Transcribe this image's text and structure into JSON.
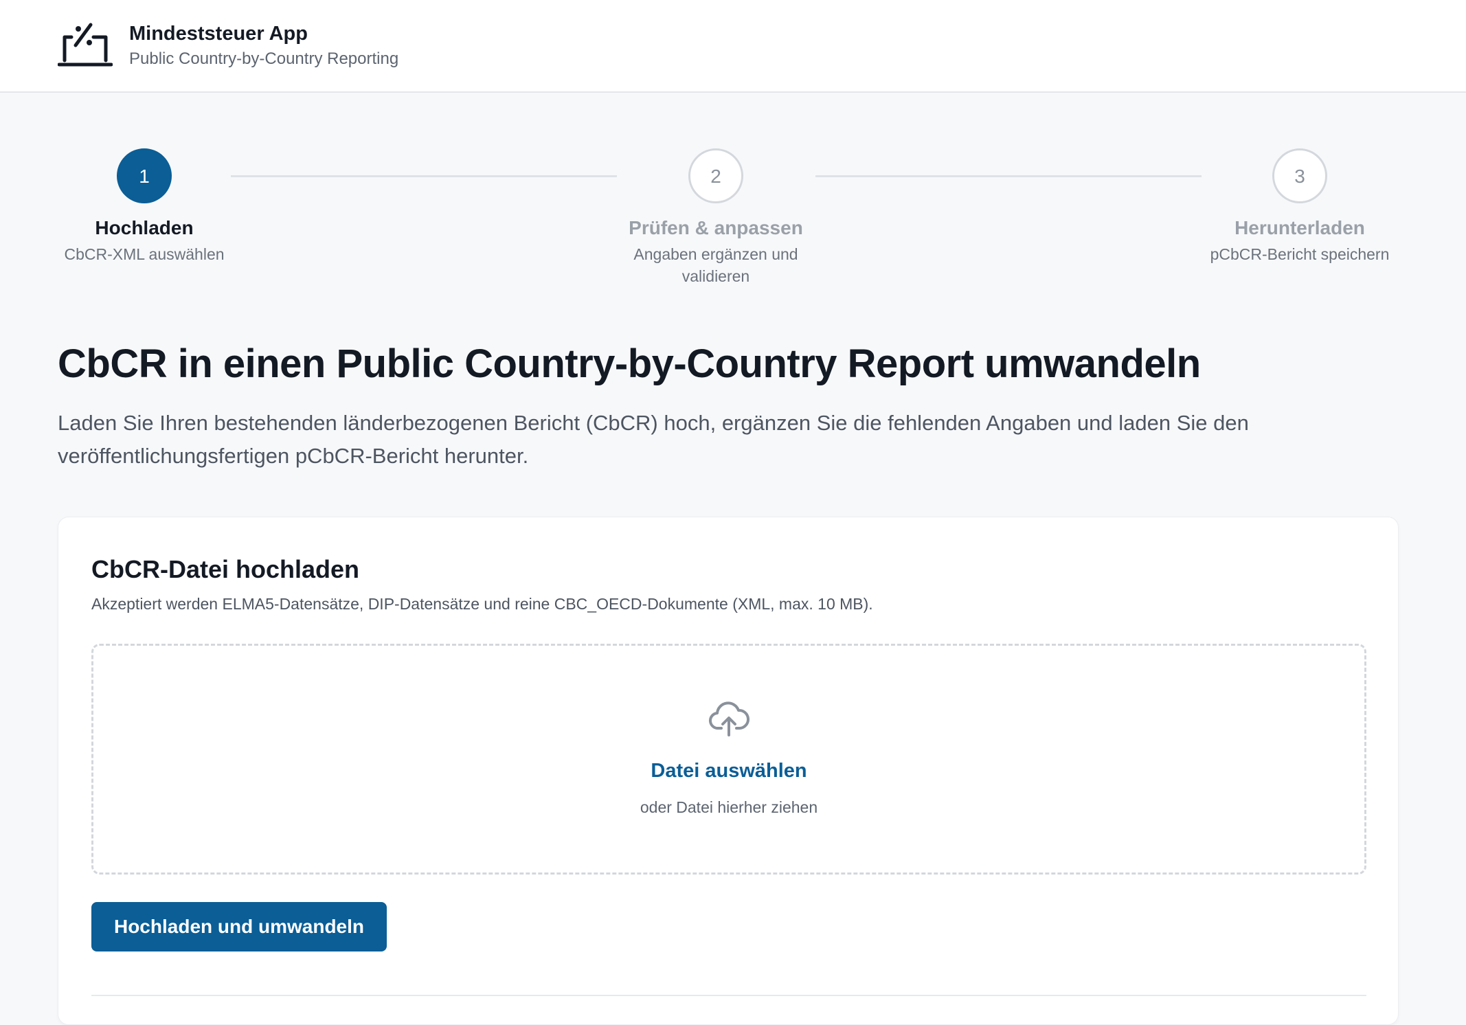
{
  "header": {
    "app_title": "Mindeststeuer App",
    "app_subtitle": "Public Country-by-Country Reporting",
    "logo_icon": "percent-laptop-icon"
  },
  "stepper": {
    "active_step": 1,
    "steps": [
      {
        "number": "1",
        "title": "Hochladen",
        "description": "CbCR-XML auswählen"
      },
      {
        "number": "2",
        "title": "Prüfen & anpassen",
        "description": "Angaben ergänzen und validieren"
      },
      {
        "number": "3",
        "title": "Herunterladen",
        "description": "pCbCR-Bericht speichern"
      }
    ]
  },
  "intro": {
    "title": "CbCR in einen Public Country-by-Country Report umwandeln",
    "description": "Laden Sie Ihren bestehenden länderbezogenen Bericht (CbCR) hoch, ergänzen Sie die fehlenden Angaben und laden Sie den veröffentlichungsfertigen pCbCR-Bericht herunter."
  },
  "upload_card": {
    "title": "CbCR-Datei hochladen",
    "description": "Akzeptiert werden ELMA5-Datensätze, DIP-Datensätze und reine CBC_OECD-Dokumente (XML, max. 10 MB).",
    "dropzone": {
      "icon": "cloud-upload-icon",
      "choose_label": "Datei auswählen",
      "hint": "oder Datei hierher ziehen"
    },
    "submit_label": "Hochladen und umwandeln"
  },
  "colors": {
    "primary": "#0b5e96",
    "text": "#141a24",
    "muted": "#5c6470",
    "background": "#f7f8fa",
    "border": "#d3d7dc"
  }
}
